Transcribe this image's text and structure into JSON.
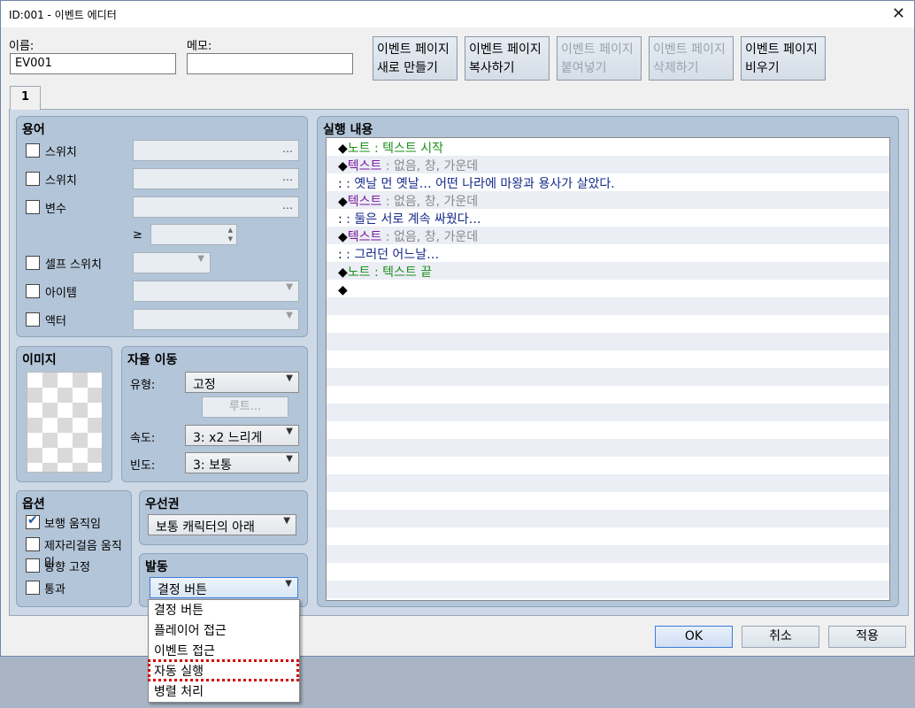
{
  "window": {
    "title": "ID:001 - 이벤트 에디터",
    "close_glyph": "✕"
  },
  "header": {
    "name_label": "이름:",
    "name_value": "EV001",
    "memo_label": "메모:",
    "memo_value": ""
  },
  "toolbar": [
    {
      "line1": "이벤트 페이지",
      "line2": "새로 만들기",
      "enabled": true
    },
    {
      "line1": "이벤트 페이지",
      "line2": "복사하기",
      "enabled": true
    },
    {
      "line1": "이벤트 페이지",
      "line2": "붙여넣기",
      "enabled": false
    },
    {
      "line1": "이벤트 페이지",
      "line2": "삭제하기",
      "enabled": false
    },
    {
      "line1": "이벤트 페이지",
      "line2": "비우기",
      "enabled": true
    }
  ],
  "tabs": [
    {
      "label": "1",
      "selected": true
    }
  ],
  "conditions": {
    "title": "용어",
    "switch1_label": "스위치",
    "switch2_label": "스위치",
    "variable_label": "변수",
    "gte_symbol": "≥",
    "self_switch_label": "셀프 스위치",
    "item_label": "아이템",
    "actor_label": "액터",
    "ellipsis": "…"
  },
  "image": {
    "title": "이미지"
  },
  "autonomous": {
    "title": "자율 이동",
    "type_label": "유형:",
    "type_value": "고정",
    "route_button": "루트...",
    "speed_label": "속도:",
    "speed_value": "3: x2 느리게",
    "freq_label": "빈도:",
    "freq_value": "3: 보통"
  },
  "options": {
    "title": "옵션",
    "items": [
      {
        "label": "보행 움직임",
        "checked": true
      },
      {
        "label": "제자리걸음 움직임",
        "checked": false
      },
      {
        "label": "방향 고정",
        "checked": false
      },
      {
        "label": "통과",
        "checked": false
      }
    ]
  },
  "priority": {
    "title": "우선권",
    "value": "보통 캐릭터의 아래"
  },
  "trigger": {
    "title": "발동",
    "value": "결정 버튼",
    "options": [
      "결정 버튼",
      "플레이어 접근",
      "이벤트 접근",
      "자동 실행",
      "병렬 처리"
    ],
    "highlighted_option": "자동 실행"
  },
  "contents": {
    "title": "실행 내용",
    "lines": [
      {
        "bullet": "◆",
        "cmd": "노트",
        "sep": " : ",
        "arg": "텍스트 시작",
        "kind": "note"
      },
      {
        "bullet": "◆",
        "cmd": "텍스트",
        "sep": " : ",
        "arg": "없음, 창, 가운데",
        "kind": "text"
      },
      {
        "bullet": "",
        "cmd": " :",
        "sep": "       : ",
        "arg": "옛날 먼 옛날… 어떤 나라에 마왕과 용사가 살았다.",
        "kind": "cont"
      },
      {
        "bullet": "◆",
        "cmd": "텍스트",
        "sep": " : ",
        "arg": "없음, 창, 가운데",
        "kind": "text"
      },
      {
        "bullet": "",
        "cmd": " :",
        "sep": "       : ",
        "arg": "둘은 서로 계속 싸웠다…",
        "kind": "cont"
      },
      {
        "bullet": "◆",
        "cmd": "텍스트",
        "sep": " : ",
        "arg": "없음, 창, 가운데",
        "kind": "text"
      },
      {
        "bullet": "",
        "cmd": " :",
        "sep": "       : ",
        "arg": "그러던 어느날…",
        "kind": "cont"
      },
      {
        "bullet": "◆",
        "cmd": "노트",
        "sep": " : ",
        "arg": "텍스트 끝",
        "kind": "note"
      },
      {
        "bullet": "◆",
        "cmd": "",
        "sep": "",
        "arg": "",
        "kind": "empty"
      }
    ]
  },
  "footer": {
    "ok": "OK",
    "cancel": "취소",
    "apply": "적용"
  },
  "colors": {
    "note": "#1a8f1a",
    "command": "#7a1aa0",
    "param": "#8a8a8a",
    "message": "#142a88",
    "highlight": "#d40000"
  }
}
